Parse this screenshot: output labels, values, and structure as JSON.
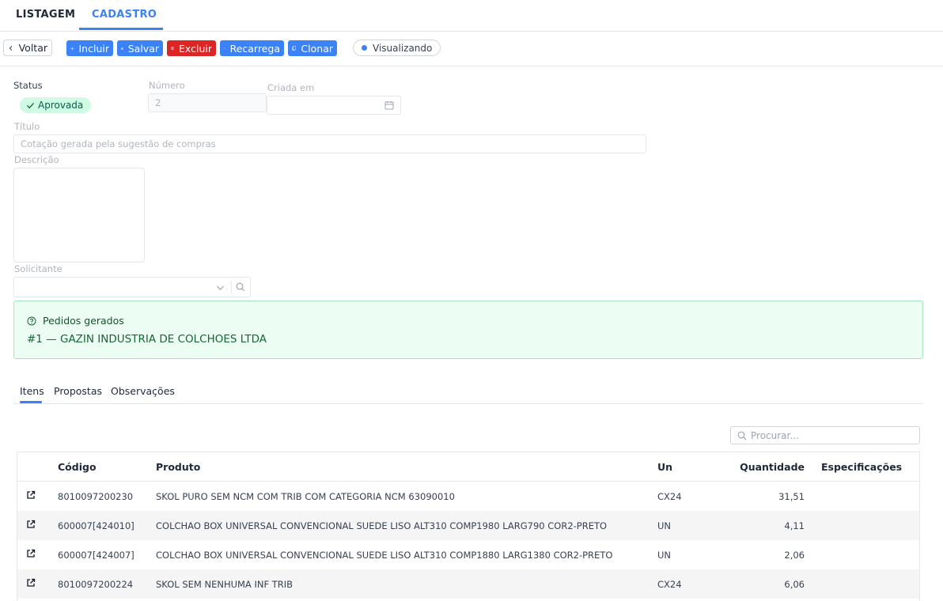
{
  "top_tabs": {
    "listagem": "LISTAGEM",
    "cadastro": "CADASTRO"
  },
  "toolbar": {
    "voltar": "Voltar",
    "incluir": "Incluir",
    "salvar": "Salvar",
    "excluir": "Excluir",
    "recarrega": "Recarrega",
    "clonar": "Clonar",
    "mode": "Visualizando"
  },
  "form": {
    "status_label": "Status",
    "status_value": "Aprovada",
    "numero_label": "Número",
    "numero_value": "2",
    "criada_label": "Criada em",
    "criada_value": "",
    "titulo_label": "Título",
    "titulo_value": "Cotação gerada pela sugestão de compras",
    "descricao_label": "Descrição",
    "descricao_value": "",
    "solicitante_label": "Solicitante",
    "solicitante_value": ""
  },
  "pedidos": {
    "header": "Pedidos gerados",
    "item": "#1 — GAZIN INDUSTRIA DE COLCHOES LTDA"
  },
  "sub_tabs": {
    "itens": "Itens",
    "propostas": "Propostas",
    "observacoes": "Observações"
  },
  "search": {
    "placeholder": "Procurar..."
  },
  "table": {
    "columns": {
      "codigo": "Código",
      "produto": "Produto",
      "un": "Un",
      "quantidade": "Quantidade",
      "especificacoes": "Especificações"
    },
    "rows": [
      {
        "codigo": "8010097200230",
        "produto": "SKOL PURO SEM NCM COM TRIB COM CATEGORIA NCM 63090010",
        "un": "CX24",
        "quantidade": "31,51",
        "especificacoes": ""
      },
      {
        "codigo": "600007[424010]",
        "produto": "COLCHAO BOX UNIVERSAL CONVENCIONAL SUEDE LISO ALT310 COMP1980 LARG790 COR2-PRETO",
        "un": "UN",
        "quantidade": "4,11",
        "especificacoes": ""
      },
      {
        "codigo": "600007[424007]",
        "produto": "COLCHAO BOX UNIVERSAL CONVENCIONAL SUEDE LISO ALT310 COMP1880 LARG1380 COR2-PRETO",
        "un": "UN",
        "quantidade": "2,06",
        "especificacoes": ""
      },
      {
        "codigo": "8010097200224",
        "produto": "SKOL SEM NENHUMA INF TRIB",
        "un": "CX24",
        "quantidade": "6,06",
        "especificacoes": ""
      }
    ]
  },
  "colors": {
    "primary": "#3b82f6",
    "danger": "#dc2626",
    "success_bg": "#ecfdf3",
    "success_text": "#166534"
  },
  "icons": [
    "chevron-left-icon",
    "plus-icon",
    "save-icon",
    "trash-icon",
    "refresh-icon",
    "copy-icon",
    "check-icon",
    "calendar-icon",
    "chevron-down-icon",
    "search-icon",
    "help-circle-icon",
    "external-link-icon"
  ]
}
